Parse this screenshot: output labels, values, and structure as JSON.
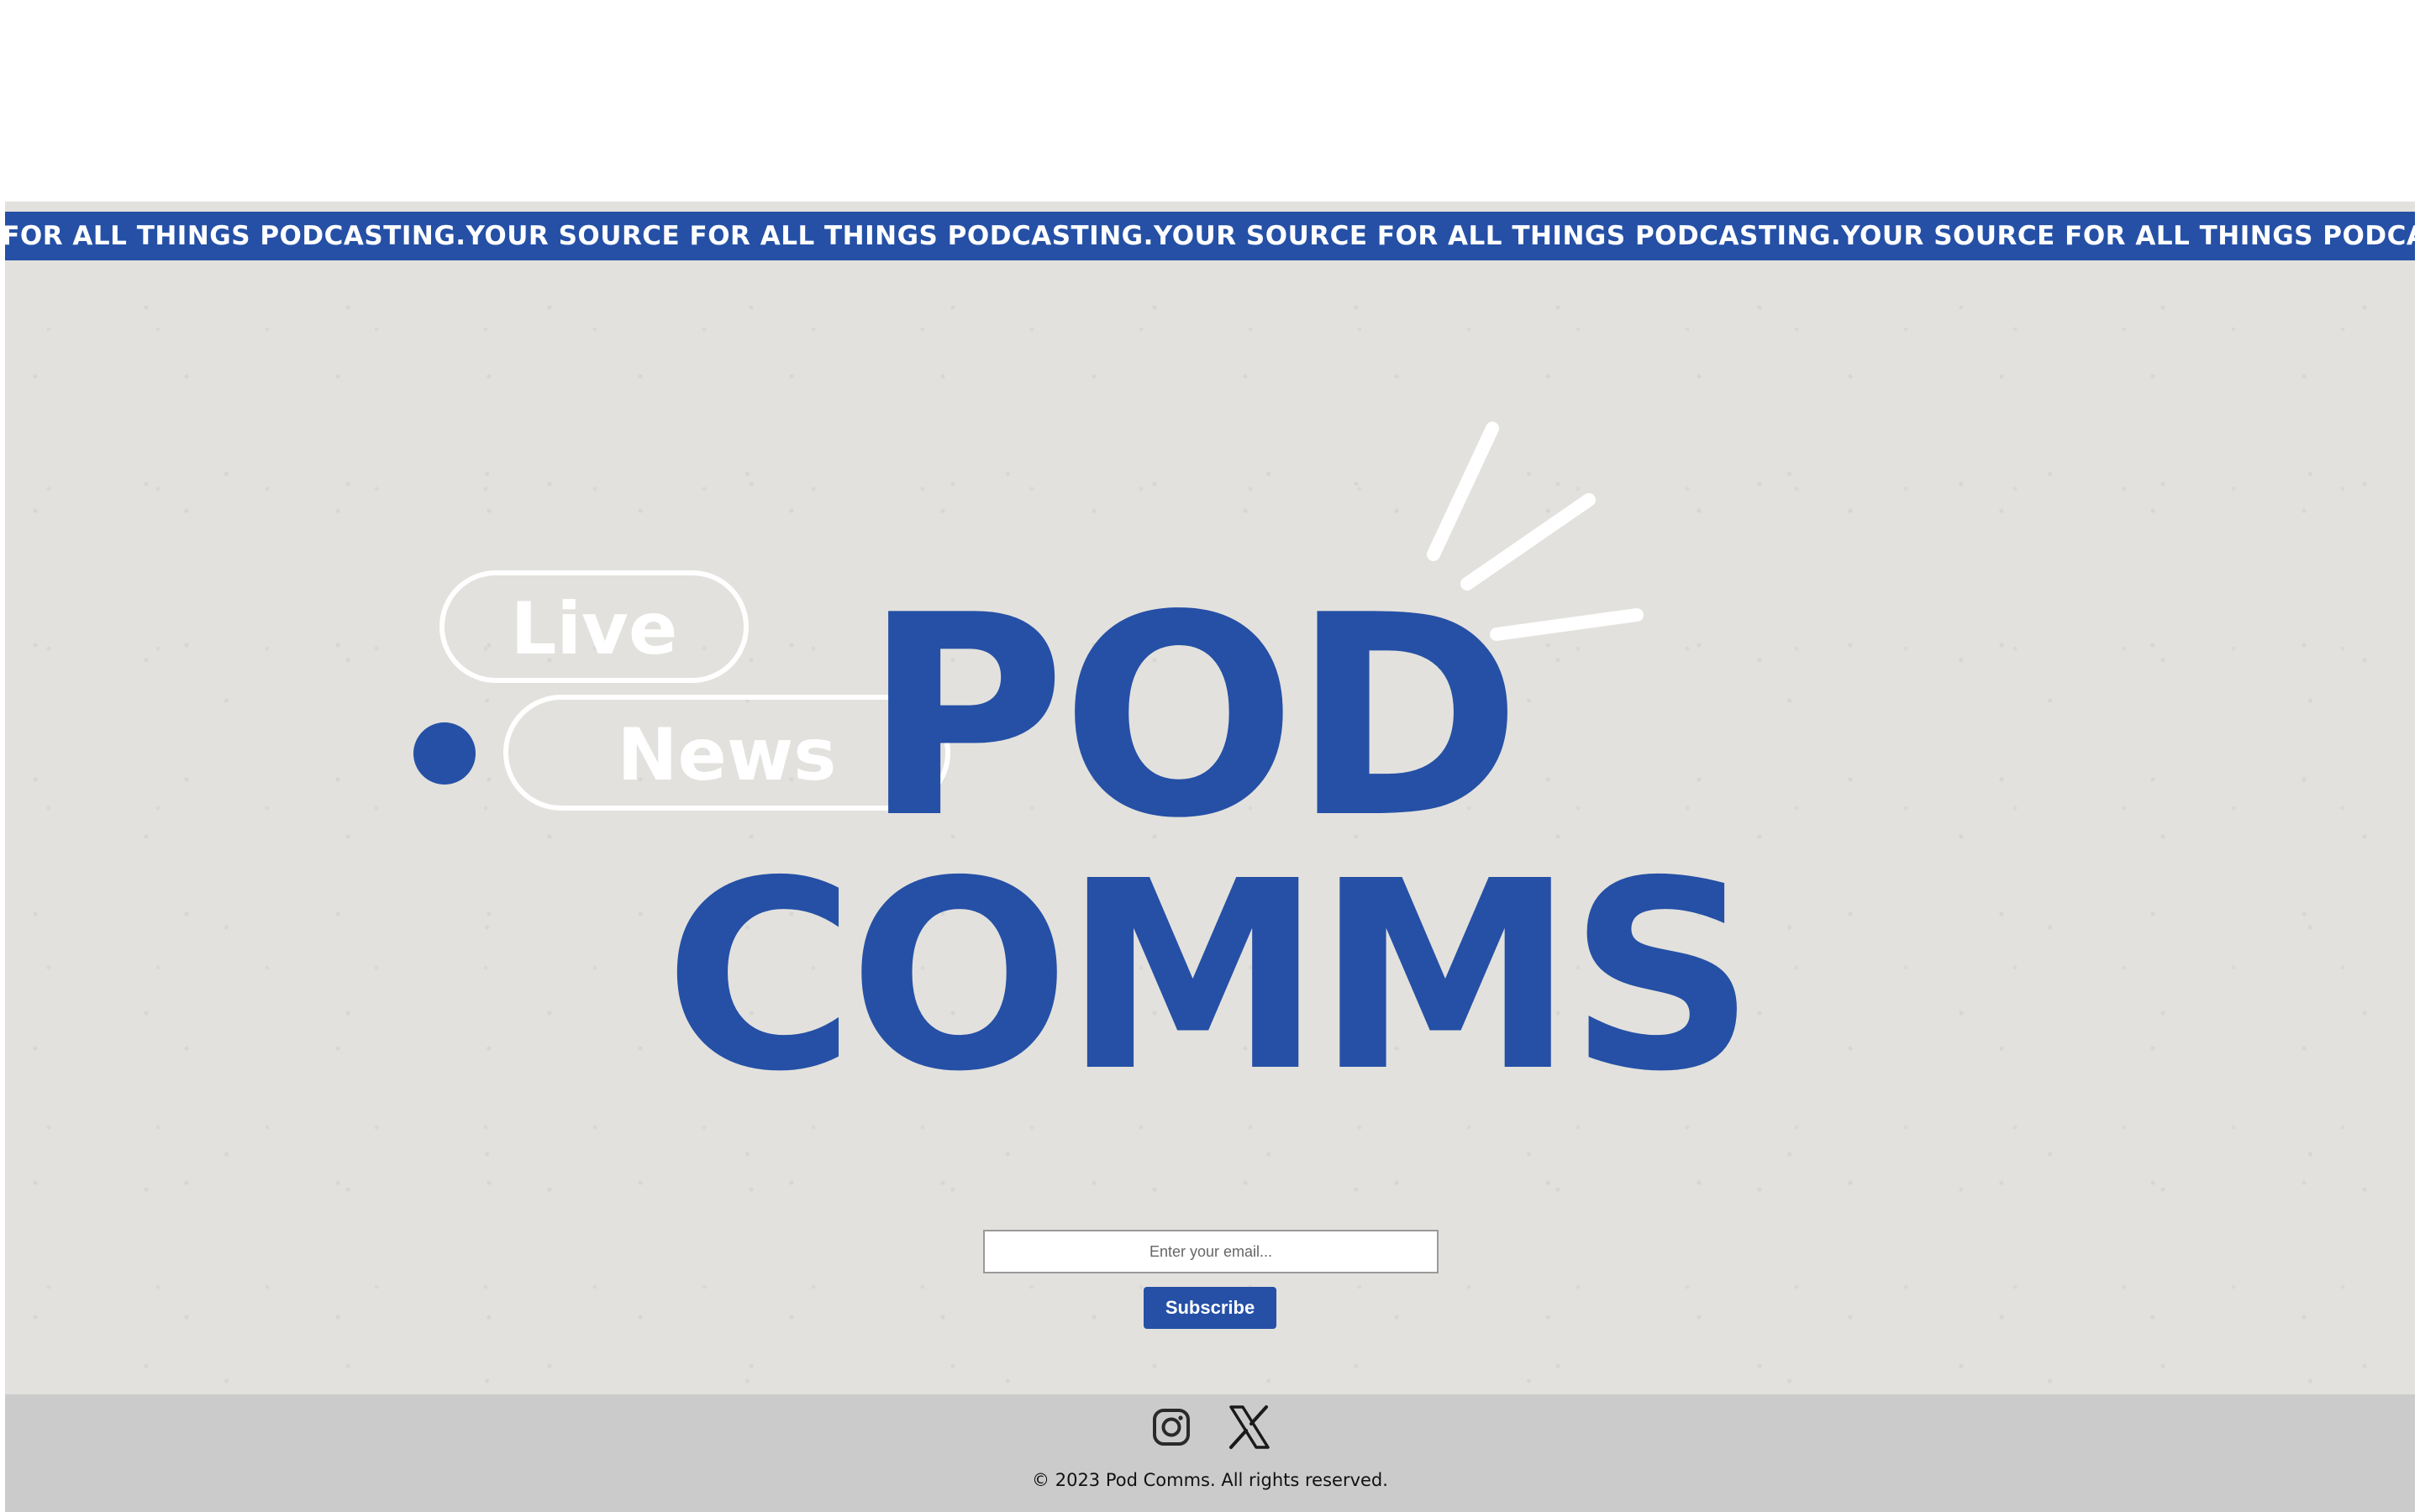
{
  "ticker": {
    "text": "CE FOR ALL THINGS PODCASTING.YOUR SOURCE FOR ALL THINGS PODCASTING.YOUR SOURCE FOR ALL THINGS PODCASTING.YOUR SOURCE FOR ALL THINGS PODCASTING.YOUR SOURCE FOR A"
  },
  "logo": {
    "tag_live": "Live",
    "tag_news": "News",
    "line1": "POD",
    "line2": "COMMS"
  },
  "subscribe": {
    "email_placeholder": "Enter your email...",
    "button_label": "Subscribe"
  },
  "footer": {
    "social_icons": [
      "instagram-icon",
      "x-twitter-icon"
    ],
    "copyright": "© 2023 Pod Comms. All rights reserved."
  },
  "colors": {
    "brand_blue": "#2550a6",
    "hero_background": "#e3e1dd",
    "footer_background": "#cbcbcb"
  }
}
